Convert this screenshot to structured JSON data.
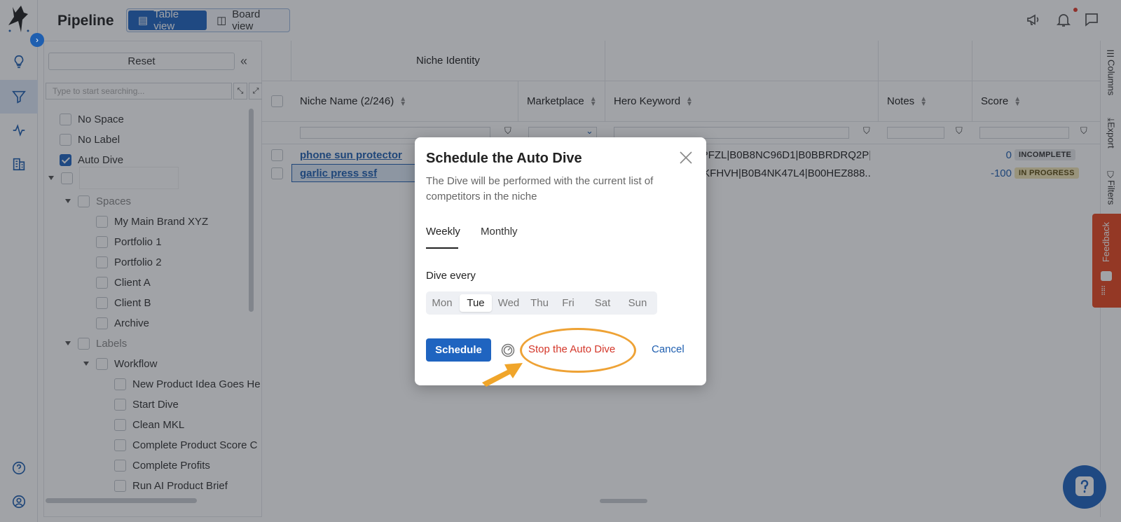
{
  "app": {
    "title": "Pipeline",
    "views": [
      {
        "label": "Table view",
        "active": true
      },
      {
        "label": "Board view",
        "active": false
      }
    ],
    "accent": "#1f64c0"
  },
  "filters": {
    "reset_label": "Reset",
    "search_placeholder": "Type to start searching...",
    "items": {
      "no_space": "No Space",
      "no_label": "No Label",
      "auto_dive": "Auto Dive",
      "spaces": "Spaces",
      "my_main_brand": "My Main Brand XYZ",
      "portfolio1": "Portfolio 1",
      "portfolio2": "Portfolio 2",
      "client_a": "Client A",
      "client_b": "Client B",
      "archive": "Archive",
      "labels": "Labels",
      "workflow": "Workflow",
      "new_product_idea": "New Product Idea Goes He",
      "start_dive": "Start Dive",
      "clean_mkl": "Clean MKL",
      "complete_product_score": "Complete Product Score C",
      "complete_profits": "Complete Profits",
      "run_ai_brief": "Run AI Product Brief"
    }
  },
  "grid": {
    "group_header": "Niche Identity",
    "columns": {
      "niche_name": "Niche Name (2/246)",
      "marketplace": "Marketplace",
      "hero_keyword": "Hero Keyword",
      "notes": "Notes",
      "score": "Score"
    },
    "rows": [
      {
        "name": "phone sun protector",
        "hero": "37PFZL|B0B8NC96D1|B0BBRDRQ2P|...",
        "score": "0",
        "status": "INCOMPLETE"
      },
      {
        "name": "garlic press ssf",
        "hero": "N7KFHVH|B0B4NK47L4|B00HEZ888...",
        "score": "-100",
        "status": "IN PROGRESS"
      }
    ]
  },
  "side_tabs": {
    "columns": "Columns",
    "export": "Export",
    "filters": "Filters",
    "feedback": "Feedback"
  },
  "modal": {
    "title": "Schedule the Auto Dive",
    "description": "The Dive will be performed with the current list of competitors in the niche",
    "tabs": {
      "weekly": "Weekly",
      "monthly": "Monthly"
    },
    "dive_every_label": "Dive every",
    "days": {
      "mon": "Mon",
      "tue": "Tue",
      "wed": "Wed",
      "thu": "Thu",
      "fri": "Fri",
      "sat": "Sat",
      "sun": "Sun"
    },
    "selected_day": "Tue",
    "schedule_label": "Schedule",
    "stop_label": "Stop the Auto Dive",
    "cancel_label": "Cancel",
    "stop_color": "#d4372a",
    "highlight_color": "#eea235"
  }
}
